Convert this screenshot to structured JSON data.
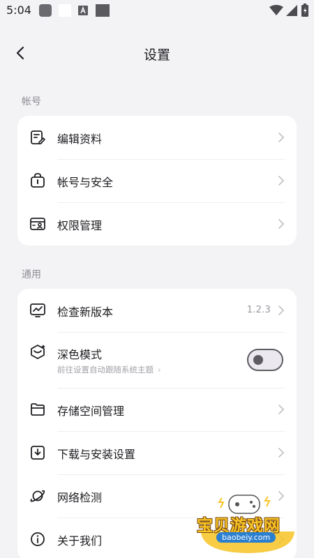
{
  "status_bar": {
    "time": "5:04",
    "icons": [
      "notification-square-icon",
      "white-square-icon",
      "font-a-icon",
      "dark-square-icon",
      "wifi-icon",
      "signal-icon",
      "battery-icon"
    ]
  },
  "header": {
    "title": "设置",
    "back_icon": "back-arrow-icon"
  },
  "sections": {
    "account": {
      "label": "帐号",
      "items": [
        {
          "label": "编辑资料",
          "icon": "edit-profile-icon"
        },
        {
          "label": "帐号与安全",
          "icon": "lock-icon"
        },
        {
          "label": "权限管理",
          "icon": "permission-card-icon"
        }
      ]
    },
    "general": {
      "label": "通用",
      "items": [
        {
          "label": "检查新版本",
          "icon": "update-chart-icon",
          "value": "1.2.3"
        },
        {
          "label": "深色模式",
          "icon": "dark-mode-cube-icon",
          "subtitle": "前往设置自动跟随系统主题",
          "toggle_on": false
        },
        {
          "label": "存储空间管理",
          "icon": "folder-icon"
        },
        {
          "label": "下载与安装设置",
          "icon": "download-icon"
        },
        {
          "label": "网络检测",
          "icon": "planet-network-icon"
        },
        {
          "label": "关于我们",
          "icon": "info-icon"
        }
      ]
    }
  },
  "watermark": {
    "text": "宝贝游戏网",
    "domain": "baobeiy.com"
  },
  "colors": {
    "background": "#f3f3f5",
    "card": "#ffffff",
    "text_primary": "#1e1e22",
    "text_secondary": "#8e8e93",
    "watermark_yellow": "#f7c325",
    "watermark_blue": "#2a7fd0"
  }
}
